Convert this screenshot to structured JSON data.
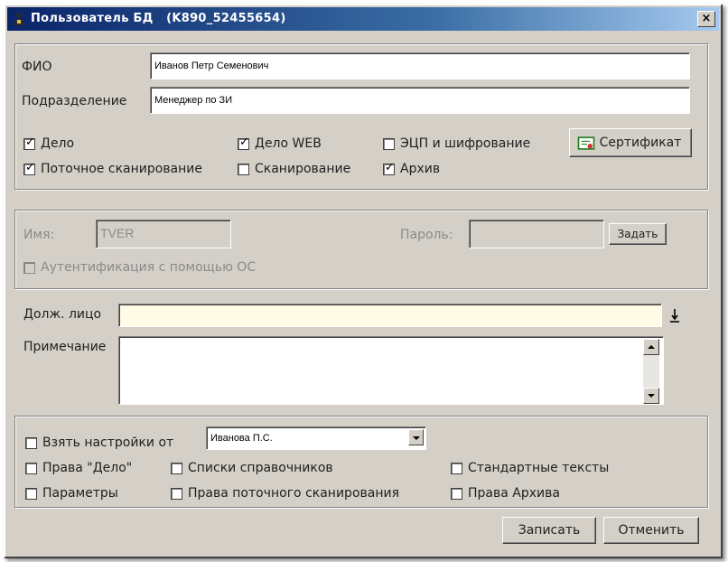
{
  "window": {
    "title": "Пользователь БД   (K890_52455654)",
    "close_label": "×"
  },
  "user_group": {
    "fio_label": "ФИО",
    "fio_value": "Иванов Петр Семенович",
    "dept_label": "Подразделение",
    "dept_value": "Менеджер по ЗИ",
    "checkboxes": [
      {
        "label": "Дело",
        "checked": true
      },
      {
        "label": "Дело WEB",
        "checked": true
      },
      {
        "label": "ЭЦП и шифрование",
        "checked": false
      },
      {
        "label": "Поточное сканирование",
        "checked": true
      },
      {
        "label": "Сканирование",
        "checked": false
      },
      {
        "label": "Архив",
        "checked": true
      }
    ],
    "certificate_button": "Сертификат"
  },
  "auth_group": {
    "name_label": "Имя:",
    "name_value": "TVER",
    "password_label": "Пароль:",
    "password_value": "",
    "set_button": "Задать",
    "os_auth_label": "Аутентификация с помощью ОС",
    "os_auth_checked": false
  },
  "official": {
    "label": "Долж. лицо",
    "value": "",
    "picker_icon": "down-arrow-underline-icon"
  },
  "note": {
    "label": "Примечание",
    "value": ""
  },
  "settings_group": {
    "take_settings_label": "Взять настройки от",
    "take_settings_checked": false,
    "take_settings_value": "Иванова П.С.",
    "options": [
      {
        "label": "Права \"Дело\"",
        "checked": false
      },
      {
        "label": "Списки справочников",
        "checked": false
      },
      {
        "label": "Стандартные тексты",
        "checked": false
      },
      {
        "label": "Параметры",
        "checked": false
      },
      {
        "label": "Права поточного сканирования",
        "checked": false
      },
      {
        "label": "Права Архива",
        "checked": false
      }
    ]
  },
  "footer": {
    "save_button": "Записать",
    "cancel_button": "Отменить"
  }
}
